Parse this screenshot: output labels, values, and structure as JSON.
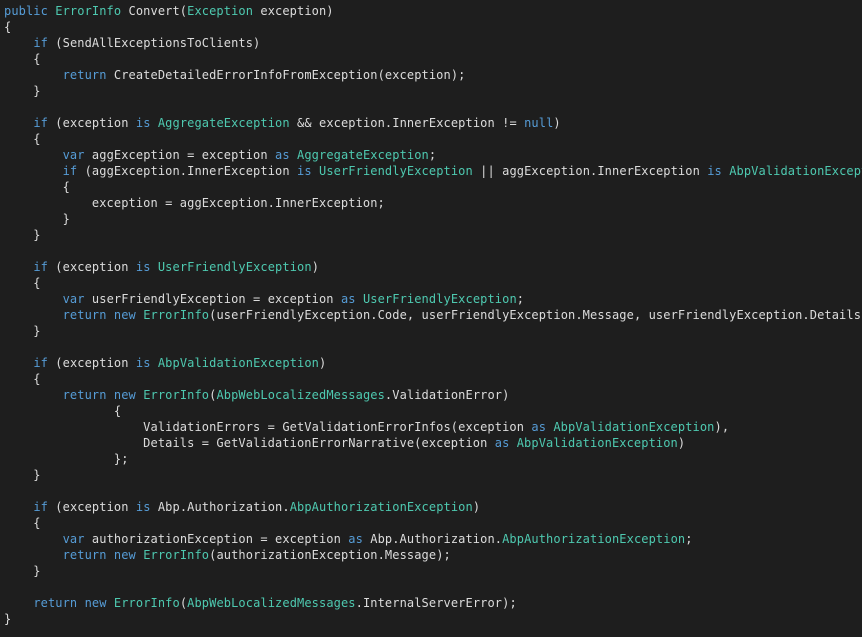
{
  "colors": {
    "background": "#1e1e1e",
    "plain": "#dcdcdc",
    "keyword": "#569cd6",
    "type": "#4ec9b0"
  },
  "code": {
    "language": "C#",
    "lines": [
      [
        [
          "kw",
          "public"
        ],
        [
          "plain",
          " "
        ],
        [
          "type",
          "ErrorInfo"
        ],
        [
          "plain",
          " Convert("
        ],
        [
          "type",
          "Exception"
        ],
        [
          "plain",
          " exception)"
        ]
      ],
      [
        [
          "plain",
          "{"
        ]
      ],
      [
        [
          "plain",
          "    "
        ],
        [
          "kw",
          "if"
        ],
        [
          "plain",
          " (SendAllExceptionsToClients)"
        ]
      ],
      [
        [
          "plain",
          "    {"
        ]
      ],
      [
        [
          "plain",
          "        "
        ],
        [
          "kw",
          "return"
        ],
        [
          "plain",
          " CreateDetailedErrorInfoFromException(exception);"
        ]
      ],
      [
        [
          "plain",
          "    }"
        ]
      ],
      [],
      [
        [
          "plain",
          "    "
        ],
        [
          "kw",
          "if"
        ],
        [
          "plain",
          " (exception "
        ],
        [
          "kw",
          "is"
        ],
        [
          "plain",
          " "
        ],
        [
          "type",
          "AggregateException"
        ],
        [
          "plain",
          " && exception.InnerException != "
        ],
        [
          "kw",
          "null"
        ],
        [
          "plain",
          ")"
        ]
      ],
      [
        [
          "plain",
          "    {"
        ]
      ],
      [
        [
          "plain",
          "        "
        ],
        [
          "kw",
          "var"
        ],
        [
          "plain",
          " aggException = exception "
        ],
        [
          "kw",
          "as"
        ],
        [
          "plain",
          " "
        ],
        [
          "type",
          "AggregateException"
        ],
        [
          "plain",
          ";"
        ]
      ],
      [
        [
          "plain",
          "        "
        ],
        [
          "kw",
          "if"
        ],
        [
          "plain",
          " (aggException.InnerException "
        ],
        [
          "kw",
          "is"
        ],
        [
          "plain",
          " "
        ],
        [
          "type",
          "UserFriendlyException"
        ],
        [
          "plain",
          " || aggException.InnerException "
        ],
        [
          "kw",
          "is"
        ],
        [
          "plain",
          " "
        ],
        [
          "type",
          "AbpValidationException"
        ],
        [
          "plain",
          ")"
        ]
      ],
      [
        [
          "plain",
          "        {"
        ]
      ],
      [
        [
          "plain",
          "            exception = aggException.InnerException;"
        ]
      ],
      [
        [
          "plain",
          "        }"
        ]
      ],
      [
        [
          "plain",
          "    }"
        ]
      ],
      [],
      [
        [
          "plain",
          "    "
        ],
        [
          "kw",
          "if"
        ],
        [
          "plain",
          " (exception "
        ],
        [
          "kw",
          "is"
        ],
        [
          "plain",
          " "
        ],
        [
          "type",
          "UserFriendlyException"
        ],
        [
          "plain",
          ")"
        ]
      ],
      [
        [
          "plain",
          "    {"
        ]
      ],
      [
        [
          "plain",
          "        "
        ],
        [
          "kw",
          "var"
        ],
        [
          "plain",
          " userFriendlyException = exception "
        ],
        [
          "kw",
          "as"
        ],
        [
          "plain",
          " "
        ],
        [
          "type",
          "UserFriendlyException"
        ],
        [
          "plain",
          ";"
        ]
      ],
      [
        [
          "plain",
          "        "
        ],
        [
          "kw",
          "return"
        ],
        [
          "plain",
          " "
        ],
        [
          "kw",
          "new"
        ],
        [
          "plain",
          " "
        ],
        [
          "type",
          "ErrorInfo"
        ],
        [
          "plain",
          "(userFriendlyException.Code, userFriendlyException.Message, userFriendlyException.Details);"
        ]
      ],
      [
        [
          "plain",
          "    }"
        ]
      ],
      [],
      [
        [
          "plain",
          "    "
        ],
        [
          "kw",
          "if"
        ],
        [
          "plain",
          " (exception "
        ],
        [
          "kw",
          "is"
        ],
        [
          "plain",
          " "
        ],
        [
          "type",
          "AbpValidationException"
        ],
        [
          "plain",
          ")"
        ]
      ],
      [
        [
          "plain",
          "    {"
        ]
      ],
      [
        [
          "plain",
          "        "
        ],
        [
          "kw",
          "return"
        ],
        [
          "plain",
          " "
        ],
        [
          "kw",
          "new"
        ],
        [
          "plain",
          " "
        ],
        [
          "type",
          "ErrorInfo"
        ],
        [
          "plain",
          "("
        ],
        [
          "type",
          "AbpWebLocalizedMessages"
        ],
        [
          "plain",
          ".ValidationError)"
        ]
      ],
      [
        [
          "plain",
          "               {"
        ]
      ],
      [
        [
          "plain",
          "                   ValidationErrors = GetValidationErrorInfos(exception "
        ],
        [
          "kw",
          "as"
        ],
        [
          "plain",
          " "
        ],
        [
          "type",
          "AbpValidationException"
        ],
        [
          "plain",
          "),"
        ]
      ],
      [
        [
          "plain",
          "                   Details = GetValidationErrorNarrative(exception "
        ],
        [
          "kw",
          "as"
        ],
        [
          "plain",
          " "
        ],
        [
          "type",
          "AbpValidationException"
        ],
        [
          "plain",
          ")"
        ]
      ],
      [
        [
          "plain",
          "               };"
        ]
      ],
      [
        [
          "plain",
          "    }"
        ]
      ],
      [],
      [
        [
          "plain",
          "    "
        ],
        [
          "kw",
          "if"
        ],
        [
          "plain",
          " (exception "
        ],
        [
          "kw",
          "is"
        ],
        [
          "plain",
          " Abp.Authorization."
        ],
        [
          "type",
          "AbpAuthorizationException"
        ],
        [
          "plain",
          ")"
        ]
      ],
      [
        [
          "plain",
          "    {"
        ]
      ],
      [
        [
          "plain",
          "        "
        ],
        [
          "kw",
          "var"
        ],
        [
          "plain",
          " authorizationException = exception "
        ],
        [
          "kw",
          "as"
        ],
        [
          "plain",
          " Abp.Authorization."
        ],
        [
          "type",
          "AbpAuthorizationException"
        ],
        [
          "plain",
          ";"
        ]
      ],
      [
        [
          "plain",
          "        "
        ],
        [
          "kw",
          "return"
        ],
        [
          "plain",
          " "
        ],
        [
          "kw",
          "new"
        ],
        [
          "plain",
          " "
        ],
        [
          "type",
          "ErrorInfo"
        ],
        [
          "plain",
          "(authorizationException.Message);"
        ]
      ],
      [
        [
          "plain",
          "    }"
        ]
      ],
      [],
      [
        [
          "plain",
          "    "
        ],
        [
          "kw",
          "return"
        ],
        [
          "plain",
          " "
        ],
        [
          "kw",
          "new"
        ],
        [
          "plain",
          " "
        ],
        [
          "type",
          "ErrorInfo"
        ],
        [
          "plain",
          "("
        ],
        [
          "type",
          "AbpWebLocalizedMessages"
        ],
        [
          "plain",
          ".InternalServerError);"
        ]
      ],
      [
        [
          "plain",
          "}"
        ]
      ]
    ]
  }
}
